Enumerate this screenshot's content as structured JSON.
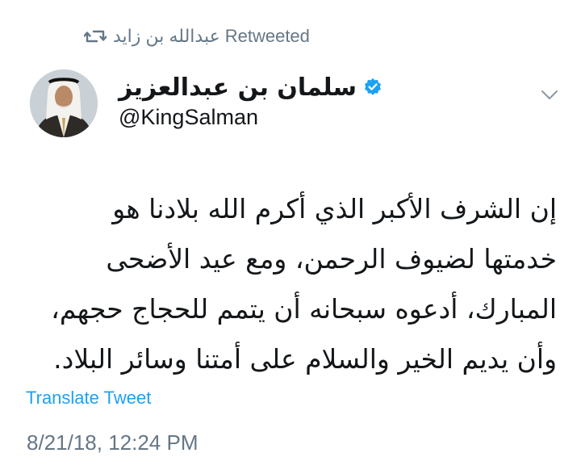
{
  "retweet": {
    "user": "عبدالله بن زايد",
    "label": "Retweeted"
  },
  "author": {
    "name": "سلمان بن عبدالعزيز",
    "handle": "@KingSalman",
    "verified": true
  },
  "tweet": {
    "lines": [
      "إن الشرف الأكبر الذي أكرم الله بلادنا هو",
      "خدمتها لضيوف الرحمن، ومع عيد الأضحى",
      "المبارك، أدعوه سبحانه أن يتمم للحجاج حجهم،",
      "وأن يديم الخير والسلام على أمتنا وسائر البلاد."
    ]
  },
  "translate_label": "Translate Tweet",
  "timestamp": "8/21/18, 12:24 PM",
  "colors": {
    "link": "#1da1f2",
    "secondary": "#657786",
    "text": "#14171a"
  },
  "icons": {
    "retweet": "retweet-icon",
    "verified": "verified-badge-icon",
    "menu": "chevron-down-icon"
  }
}
